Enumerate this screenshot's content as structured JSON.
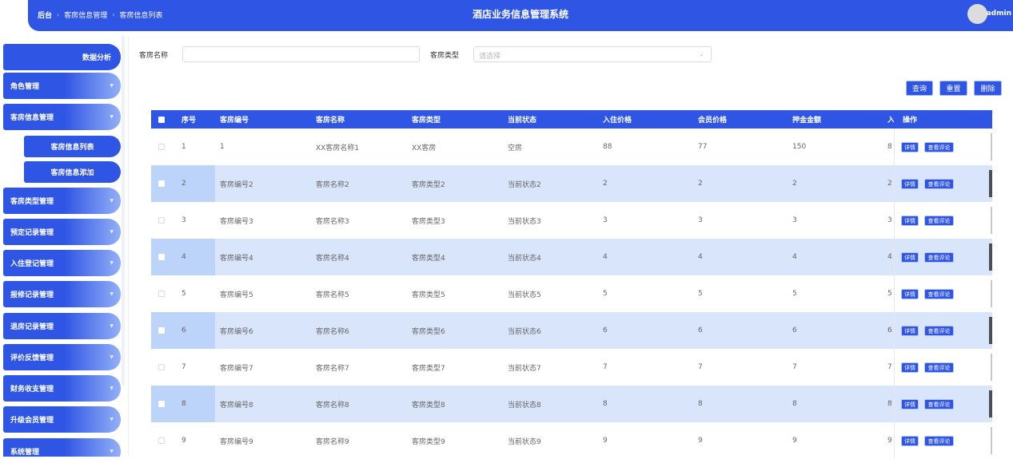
{
  "header": {
    "breadcrumb": [
      "后台",
      "客房信息管理",
      "客房信息列表"
    ],
    "breadcrumb_sep": "›",
    "title": "酒店业务信息管理系统",
    "user": "admin"
  },
  "sidebar": {
    "top_button": "数据分析",
    "menus": [
      "角色管理",
      "客房信息管理",
      "客房类型管理",
      "预定记录管理",
      "入住登记管理",
      "报修记录管理",
      "退房记录管理",
      "评价反馈管理",
      "财务收支管理",
      "升级会员管理",
      "系统管理"
    ],
    "submenu": [
      "客房信息列表",
      "客房信息添加"
    ],
    "arrow": "▼"
  },
  "search": {
    "name_label": "客房名称",
    "name_value": "",
    "type_label": "客房类型",
    "type_placeholder": "请选择",
    "type_arrow": "⌄"
  },
  "actions": {
    "query": "查询",
    "reset": "重置",
    "delete": "删除"
  },
  "table": {
    "headers": [
      "序号",
      "客房编号",
      "客房名称",
      "客房类型",
      "当前状态",
      "入住价格",
      "会员价格",
      "押金金额",
      "入住",
      "操作"
    ],
    "rows": [
      [
        "1",
        "1",
        "XX客房名称1",
        "XX客房",
        "空房",
        "88",
        "77",
        "150",
        "8"
      ],
      [
        "2",
        "客房编号2",
        "客房名称2",
        "客房类型2",
        "当前状态2",
        "2",
        "2",
        "2",
        "2"
      ],
      [
        "3",
        "客房编号3",
        "客房名称3",
        "客房类型3",
        "当前状态3",
        "3",
        "3",
        "3",
        "3"
      ],
      [
        "4",
        "客房编号4",
        "客房名称4",
        "客房类型4",
        "当前状态4",
        "4",
        "4",
        "4",
        "4"
      ],
      [
        "5",
        "客房编号5",
        "客房名称5",
        "客房类型5",
        "当前状态5",
        "5",
        "5",
        "5",
        "5"
      ],
      [
        "6",
        "客房编号6",
        "客房名称6",
        "客房类型6",
        "当前状态6",
        "6",
        "6",
        "6",
        "6"
      ],
      [
        "7",
        "客房编号7",
        "客房名称7",
        "客房类型7",
        "当前状态7",
        "7",
        "7",
        "7",
        "7"
      ],
      [
        "8",
        "客房编号8",
        "客房名称8",
        "客房类型8",
        "当前状态8",
        "8",
        "8",
        "8",
        "8"
      ],
      [
        "9",
        "客房编号9",
        "客房名称9",
        "客房类型9",
        "当前状态9",
        "9",
        "9",
        "9",
        "9"
      ]
    ],
    "op_detail": "详情",
    "op_comment": "查看评论"
  },
  "colors": {
    "primary": "#2f55e4",
    "row_alt": "#d8e5fb"
  }
}
